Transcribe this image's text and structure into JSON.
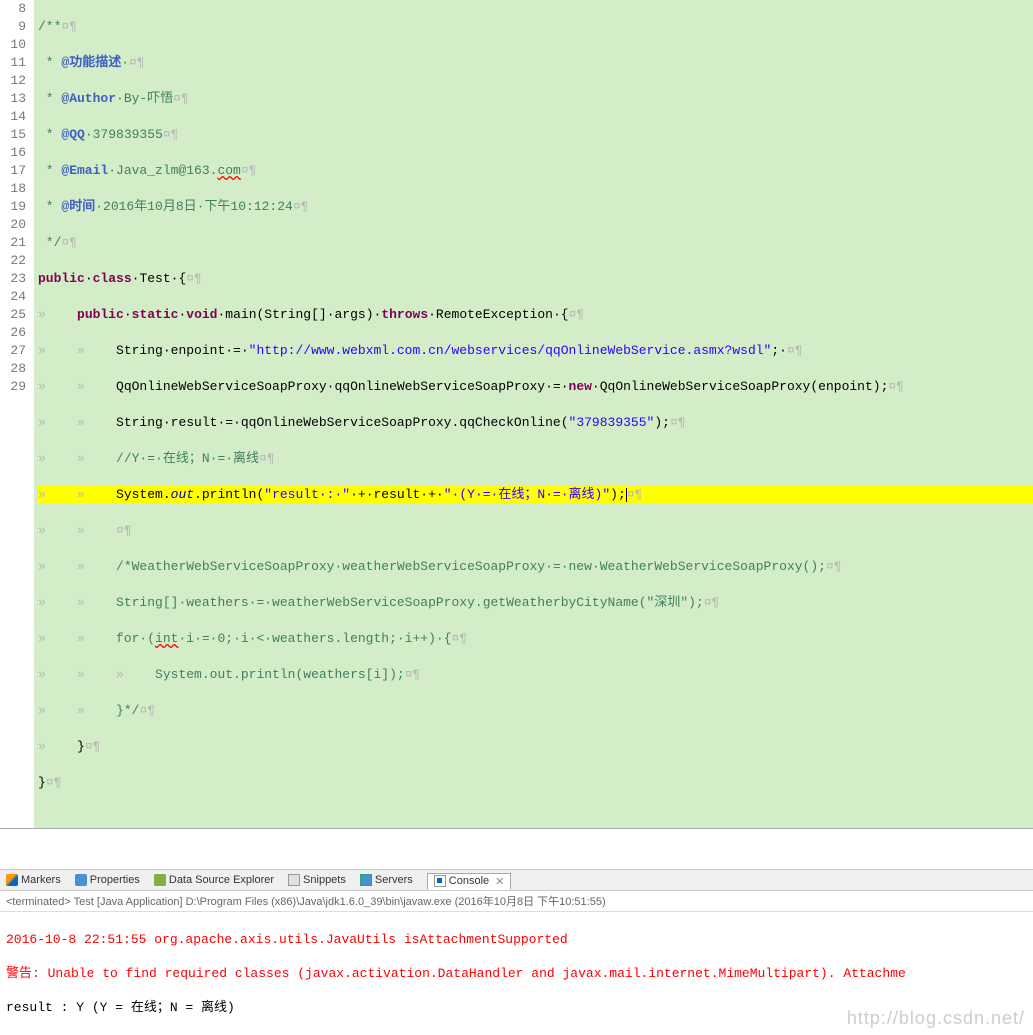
{
  "lines": {
    "n8": "8",
    "n9": "9",
    "n10": "10",
    "n11": "11",
    "n12": "12",
    "n13": "13",
    "n14": "14",
    "n15": "15",
    "n16": "16",
    "n17": "17",
    "n18": "18",
    "n19": "19",
    "n20": "20",
    "n21": "21",
    "n22": "22",
    "n23": "23",
    "n24": "24",
    "n25": "25",
    "n26": "26",
    "n27": "27",
    "n28": "28",
    "n29": "29"
  },
  "code": {
    "l8_a": "/**",
    "l9_a": " * ",
    "l9_b": "@功能描述",
    "l9_c": "·",
    "l10_a": " * ",
    "l10_b": "@Author",
    "l10_c": "·By-吓悟",
    "l11_a": " * ",
    "l11_b": "@QQ",
    "l11_c": "·379839355",
    "l12_a": " * ",
    "l12_b": "@Email",
    "l12_c": "·Java_zlm@163.",
    "l12_d": "com",
    "l13_a": " * ",
    "l13_b": "@时间",
    "l13_c": "·2016年10月8日·下午10:12:24",
    "l14_a": " */",
    "l15_a": "public",
    "l15_b": "·",
    "l15_c": "class",
    "l15_d": "·Test·{",
    "l16_a": "public",
    "l16_b": "·",
    "l16_c": "static",
    "l16_d": "·",
    "l16_e": "void",
    "l16_f": "·main(String[]·args)·",
    "l16_g": "throws",
    "l16_h": "·RemoteException·{",
    "l17_a": "String·enpoint·=·",
    "l17_b": "\"http://www.webxml.com.cn/webservices/qqOnlineWebService.asmx?wsdl\"",
    "l17_c": ";·",
    "l18_a": "QqOnlineWebServiceSoapProxy·qqOnlineWebServiceSoapProxy·=·",
    "l18_b": "new",
    "l18_c": "·QqOnlineWebServiceSoapProxy(enpoint);",
    "l19_a": "String·result·=·qqOnlineWebServiceSoapProxy.qqCheckOnline(",
    "l19_b": "\"379839355\"",
    "l19_c": ");",
    "l20_a": "//Y·=·在线；N·=·离线",
    "l21_a": "System.",
    "l21_b": "out",
    "l21_c": ".println(",
    "l21_d": "\"result·:·\"",
    "l21_e": "·+·result·+·",
    "l21_f": "\"·(Y·=·在线；N·=·离线)\"",
    "l21_g": ");",
    "l23_a": "/*WeatherWebServiceSoapProxy·weatherWebServiceSoapProxy·=·new·WeatherWebServiceSoapProxy();",
    "l24_a": "String[]·weathers·=·weatherWebServiceSoapProxy.getWeatherbyCityName(\"深圳\");",
    "l25_a": "for·(",
    "l25_b": "int",
    "l25_c": "·i·=·0;·i·<·weathers.length;·i++)·{",
    "l26_a": "System.out.println(weathers[i]);",
    "l27_a": "}*/",
    "l28_a": "}",
    "l29_a": "}"
  },
  "ws": {
    "tab": "»    ",
    "crlf": "¤¶",
    "pilcrow": "¶"
  },
  "tabs": {
    "markers": "Markers",
    "properties": "Properties",
    "dse": "Data Source Explorer",
    "snippets": "Snippets",
    "servers": "Servers",
    "console": "Console",
    "close": "✕"
  },
  "status": {
    "text": "<terminated> Test [Java Application] D:\\Program Files (x86)\\Java\\jdk1.6.0_39\\bin\\javaw.exe (2016年10月8日 下午10:51:55)"
  },
  "console": {
    "l1": "2016-10-8 22:51:55 org.apache.axis.utils.JavaUtils isAttachmentSupported",
    "l2": "警告: Unable to find required classes (javax.activation.DataHandler and javax.mail.internet.MimeMultipart). Attachme",
    "l3": "result : Y (Y = 在线；N = 离线)"
  },
  "watermark": "http://blog.csdn.net/"
}
